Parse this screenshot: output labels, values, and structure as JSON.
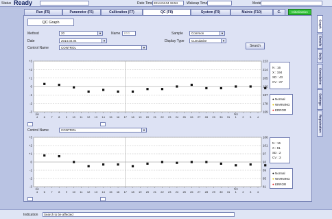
{
  "status": {
    "label": "Status",
    "value": "Ready",
    "datetime_label": "Date Time",
    "datetime": "2014.04.04 15:54",
    "wakeup_label": "Wakeup Time",
    "mode_label": "Mode",
    "green_label": "Initialization"
  },
  "tabs": [
    {
      "label": "Run (F5)"
    },
    {
      "label": "Parameter (F6)"
    },
    {
      "label": "Calibration (F7)"
    },
    {
      "label": "QC (F8)"
    },
    {
      "label": "System (F9)"
    },
    {
      "label": "Mainte (F10)"
    },
    {
      "label": "C."
    }
  ],
  "side_tabs": [
    "Graph",
    "Details",
    "Daily",
    "Cumulative",
    "Settings",
    "Registration"
  ],
  "header": {
    "title": "QC Graph"
  },
  "form": {
    "method_label": "Method",
    "method_value": "20",
    "name_label": "Name",
    "name_value": "IGG",
    "date_label": "Date",
    "date_value": "2014.02.04",
    "sample_label": "Sample",
    "sample_value": "Common",
    "display_label": "Display Type",
    "display_value": "Cumulative",
    "search_label": "Search",
    "control_label": "Control Name",
    "control_value": "CONTROL"
  },
  "chart_data": [
    {
      "type": "scatter",
      "title": "",
      "ylabels_left": [
        "+3",
        "+2",
        "+1",
        "0",
        "-1",
        "-2",
        "-3"
      ],
      "ylabels_right": [
        "223",
        "214",
        "205",
        "196",
        "187",
        "178",
        "169"
      ],
      "x_ticks": [
        "4",
        "6",
        "7",
        "8",
        "9",
        "10",
        "11",
        "12",
        "13",
        "14",
        "15",
        "16",
        "17",
        "18",
        "19",
        "20",
        "21",
        "22",
        "23",
        "24",
        "25",
        "26",
        "27",
        "28",
        "29",
        "30",
        "31",
        "1",
        "2",
        "3",
        "4"
      ],
      "x_markers": [
        "Jan",
        "Feb"
      ],
      "points_sd": [
        0.3,
        0.2,
        -0.1,
        -0.6,
        -0.4,
        -0.6,
        -0.6,
        -0.3,
        -0.3,
        0,
        0.2,
        -0.2,
        -0.2,
        0,
        0,
        -0.2
      ],
      "stats": {
        "n": "N : 16",
        "x": "X : 194",
        "sd": "SD : 43",
        "cv": "CV : 27"
      },
      "legend": [
        "Normal",
        "WARNING",
        "ERROR"
      ]
    },
    {
      "type": "scatter",
      "title": "",
      "ylabels_left": [
        "+3",
        "+2",
        "+1",
        "0",
        "-1",
        "-2",
        "-3"
      ],
      "ylabels_right": [
        "106",
        "101",
        "97",
        "93",
        "89",
        "85",
        "81"
      ],
      "x_ticks": [
        "4",
        "6",
        "7",
        "8",
        "9",
        "10",
        "11",
        "12",
        "13",
        "14",
        "15",
        "16",
        "17",
        "18",
        "19",
        "20",
        "21",
        "22",
        "23",
        "24",
        "25",
        "26",
        "27",
        "28",
        "29",
        "30",
        "31",
        "1",
        "2",
        "3",
        "4"
      ],
      "x_markers": [
        "Jan",
        "Feb"
      ],
      "points_sd": [
        0.8,
        0.7,
        0,
        -0.5,
        -0.3,
        -0.3,
        -0.5,
        -0.2,
        0,
        -0.1,
        0,
        0,
        -0.2,
        -0.4,
        -0.3,
        -0.4
      ],
      "stats": {
        "n": "N : 16",
        "x": "X : 91",
        "sd": "SD : 2",
        "cv": "CV : 3"
      },
      "legend": [
        "Normal",
        "WARNING",
        "ERROR"
      ]
    }
  ],
  "bottom": {
    "label": "Indication",
    "value": "Search to be affected"
  }
}
